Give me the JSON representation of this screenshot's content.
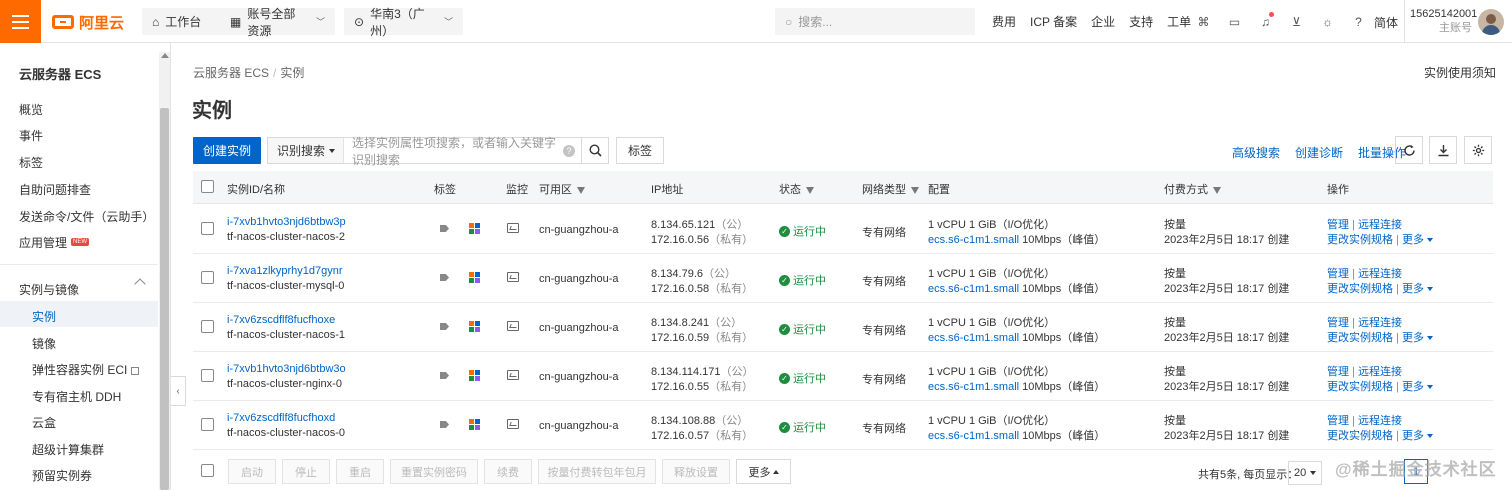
{
  "topbar": {
    "logo_text": "阿里云",
    "workbench": "工作台",
    "resources": "账号全部资源",
    "region": "华南3（广州）",
    "search_placeholder": "搜索...",
    "links": [
      "费用",
      "ICP 备案",
      "企业",
      "支持",
      "工单"
    ],
    "language": "简体",
    "account_id": "15625142001",
    "account_role": "主账号"
  },
  "sidebar": {
    "title": "云服务器 ECS",
    "items": [
      "概览",
      "事件",
      "标签",
      "自助问题排查",
      "发送命令/文件（云助手）",
      "应用管理"
    ],
    "new_badge": "NEW",
    "section_title": "实例与镜像",
    "sub_items": [
      "实例",
      "镜像",
      "弹性容器实例 ECI",
      "专有宿主机 DDH",
      "云盒",
      "超级计算集群",
      "预留实例券"
    ]
  },
  "breadcrumb": {
    "root": "云服务器 ECS",
    "sep": "/",
    "current": "实例"
  },
  "help_link": "实例使用须知",
  "page_title": "实例",
  "toolbar": {
    "create": "创建实例",
    "search_type": "识别搜索",
    "search_placeholder": "选择实例属性项搜索，或者输入关键字识别搜索",
    "tag_button": "标签",
    "advanced_search": "高级搜索",
    "create_diagnosis": "创建诊断",
    "batch_ops": "批量操作"
  },
  "table": {
    "headers": [
      "实例ID/名称",
      "标签",
      "监控",
      "可用区",
      "IP地址",
      "状态",
      "网络类型",
      "配置",
      "付费方式",
      "操作"
    ],
    "rows": [
      {
        "id": "i-7xvb1hvto3njd6btbw3p",
        "name": "tf-nacos-cluster-nacos-2",
        "zone": "cn-guangzhou-a",
        "ip_public": "8.134.65.121",
        "ip_public_tag": "（公）",
        "ip_private": "172.16.0.56",
        "ip_private_tag": "（私有）",
        "status": "运行中",
        "network": "专有网络",
        "config": "1 vCPU 1 GiB",
        "config_opt": "（I/O优化）",
        "spec": "ecs.s6-c1m1.small",
        "bandwidth": "10Mbps",
        "bw_tag": "（峰值）",
        "billing": "按量",
        "created": "2023年2月5日 18:17 创建",
        "op_manage": "管理",
        "op_remote": "远程连接",
        "op_change": "更改实例规格",
        "op_more": "更多"
      },
      {
        "id": "i-7xva1zlkyprhy1d7gynr",
        "name": "tf-nacos-cluster-mysql-0",
        "zone": "cn-guangzhou-a",
        "ip_public": "8.134.79.6",
        "ip_public_tag": "（公）",
        "ip_private": "172.16.0.58",
        "ip_private_tag": "（私有）",
        "status": "运行中",
        "network": "专有网络",
        "config": "1 vCPU 1 GiB",
        "config_opt": "（I/O优化）",
        "spec": "ecs.s6-c1m1.small",
        "bandwidth": "10Mbps",
        "bw_tag": "（峰值）",
        "billing": "按量",
        "created": "2023年2月5日 18:17 创建",
        "op_manage": "管理",
        "op_remote": "远程连接",
        "op_change": "更改实例规格",
        "op_more": "更多"
      },
      {
        "id": "i-7xv6zscdflf8fucfhoxe",
        "name": "tf-nacos-cluster-nacos-1",
        "zone": "cn-guangzhou-a",
        "ip_public": "8.134.8.241",
        "ip_public_tag": "（公）",
        "ip_private": "172.16.0.59",
        "ip_private_tag": "（私有）",
        "status": "运行中",
        "network": "专有网络",
        "config": "1 vCPU 1 GiB",
        "config_opt": "（I/O优化）",
        "spec": "ecs.s6-c1m1.small",
        "bandwidth": "10Mbps",
        "bw_tag": "（峰值）",
        "billing": "按量",
        "created": "2023年2月5日 18:17 创建",
        "op_manage": "管理",
        "op_remote": "远程连接",
        "op_change": "更改实例规格",
        "op_more": "更多"
      },
      {
        "id": "i-7xvb1hvto3njd6btbw3o",
        "name": "tf-nacos-cluster-nginx-0",
        "zone": "cn-guangzhou-a",
        "ip_public": "8.134.114.171",
        "ip_public_tag": "（公）",
        "ip_private": "172.16.0.55",
        "ip_private_tag": "（私有）",
        "status": "运行中",
        "network": "专有网络",
        "config": "1 vCPU 1 GiB",
        "config_opt": "（I/O优化）",
        "spec": "ecs.s6-c1m1.small",
        "bandwidth": "10Mbps",
        "bw_tag": "（峰值）",
        "billing": "按量",
        "created": "2023年2月5日 18:17 创建",
        "op_manage": "管理",
        "op_remote": "远程连接",
        "op_change": "更改实例规格",
        "op_more": "更多"
      },
      {
        "id": "i-7xv6zscdflf8fucfhoxd",
        "name": "tf-nacos-cluster-nacos-0",
        "zone": "cn-guangzhou-a",
        "ip_public": "8.134.108.88",
        "ip_public_tag": "（公）",
        "ip_private": "172.16.0.57",
        "ip_private_tag": "（私有）",
        "status": "运行中",
        "network": "专有网络",
        "config": "1 vCPU 1 GiB",
        "config_opt": "（I/O优化）",
        "spec": "ecs.s6-c1m1.small",
        "bandwidth": "10Mbps",
        "bw_tag": "（峰值）",
        "billing": "按量",
        "created": "2023年2月5日 18:17 创建",
        "op_manage": "管理",
        "op_remote": "远程连接",
        "op_change": "更改实例规格",
        "op_more": "更多"
      }
    ]
  },
  "footer": {
    "buttons": [
      "启动",
      "停止",
      "重启",
      "重置实例密码",
      "续费",
      "按量付费转包年包月",
      "释放设置"
    ],
    "more": "更多",
    "total": "共有5条, 每页显示：",
    "page_size": "20",
    "page": "1"
  },
  "watermark": "@稀土掘金技术社区",
  "colors": {
    "brand": "#ff6a00",
    "primary": "#0064c8",
    "running": "#1e8e3e"
  }
}
